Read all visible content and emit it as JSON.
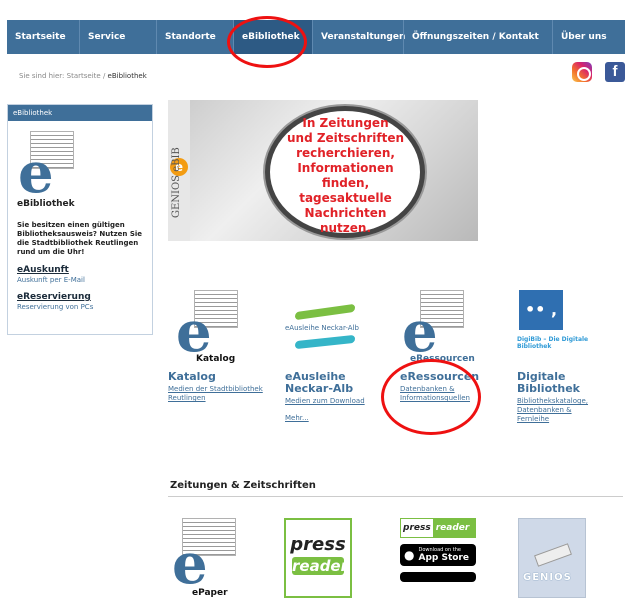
{
  "nav": {
    "items": [
      "Startseite",
      "Service",
      "Standorte",
      "eBibliothek",
      "Veranstaltungen",
      "Öffnungszeiten / Kontakt",
      "Über uns"
    ]
  },
  "breadcrumb": {
    "prefix": "Sie sind hier:",
    "home": "Startseite",
    "sep": "/",
    "current": "eBibliothek"
  },
  "social": {
    "instagram": "instagram-icon",
    "facebook": "f"
  },
  "sidebar": {
    "header": "eBibliothek",
    "title": "eBibliothek",
    "text": "Sie besitzen einen gültigen Bibliotheksausweis? Nutzen Sie die Stadtbibliothek Reutlingen rund um die Uhr!",
    "links": [
      {
        "label": "eAuskunft",
        "sub": "Auskunft per E-Mail"
      },
      {
        "label": "eReservierung",
        "sub": "Reservierung von PCs"
      }
    ]
  },
  "hero": {
    "side_text": "GENIOS eBIB",
    "lines": [
      "In Zeitungen",
      "und Zeitschriften",
      "recherchieren,",
      "Informationen finden,",
      "tagesaktuelle",
      "Nachrichten",
      "nutzen."
    ]
  },
  "tiles": [
    {
      "label": "Katalog",
      "desc": "Medien der Stadtbibliothek Reutlingen",
      "caption": "Katalog"
    },
    {
      "label": "eAusleihe Neckar-Alb",
      "desc": "Medien zum Download",
      "more": "Mehr...",
      "caption": "eAusleihe Neckar-Alb"
    },
    {
      "label": "eRessourcen",
      "desc": "Datenbanken & Informationsquellen",
      "caption": "eRessourcen"
    },
    {
      "label": "Digitale Bibliothek",
      "desc": "Bibliothekskataloge, Datenbanken & Fernleihe",
      "caption": "DigiBib – Die Digitale Bibliothek"
    }
  ],
  "section": {
    "title": "Zeitungen & Zeitschriften"
  },
  "bottom": {
    "epaper": "ePaper",
    "press1": "press",
    "press2": "reader",
    "press_small_a": "press",
    "press_small_b": "reader",
    "appstore_top": "Download on the",
    "appstore": "App Store",
    "genios": "GENIOS"
  },
  "colors": {
    "nav": "#3f6f99",
    "accent": "#e12228",
    "green": "#7bbf42"
  }
}
